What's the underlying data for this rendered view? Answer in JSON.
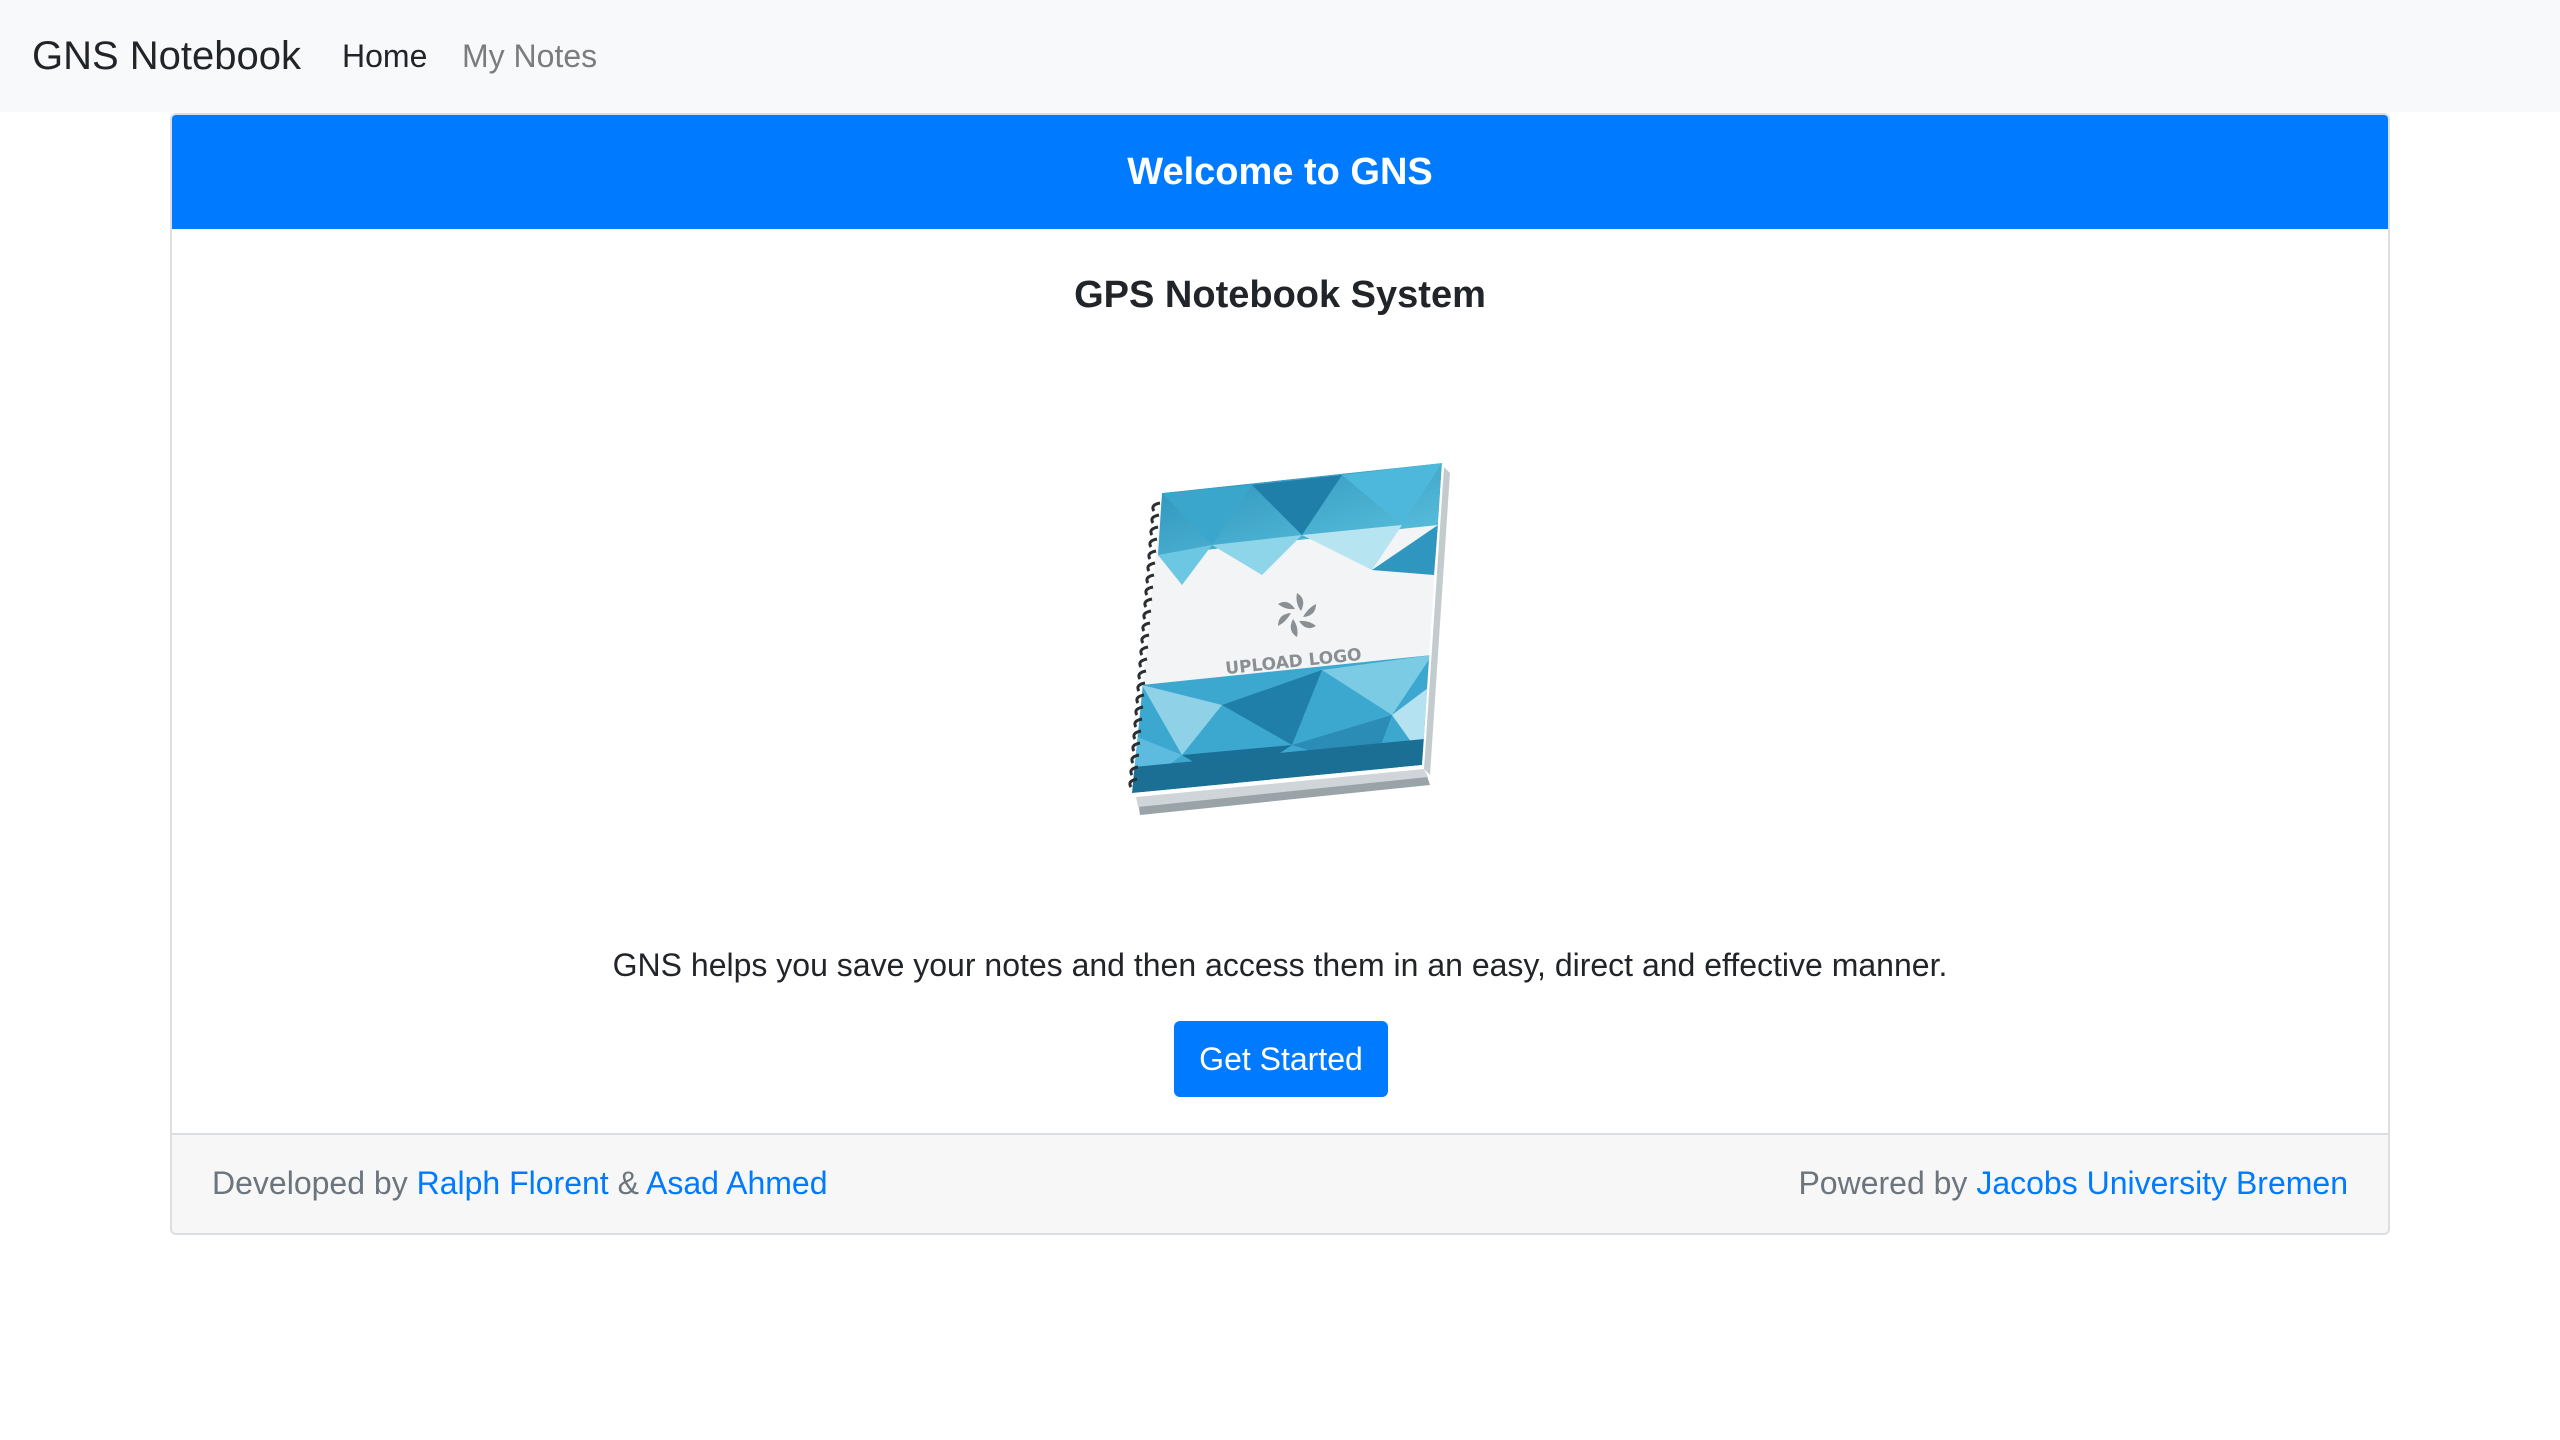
{
  "navbar": {
    "brand": "GNS Notebook",
    "links": [
      {
        "label": "Home",
        "active": true
      },
      {
        "label": "My Notes",
        "active": false
      }
    ]
  },
  "card": {
    "header": "Welcome to GNS",
    "title": "GPS Notebook System",
    "image": {
      "logo_text": "UPLOAD LOGO"
    },
    "description": "GNS helps you save your notes and then access them in an easy, direct and effective manner.",
    "button_label": "Get Started",
    "footer": {
      "developed_prefix": "Developed by ",
      "author1": "Ralph Florent",
      "separator": " & ",
      "author2": "Asad Ahmed",
      "powered_prefix": "Powered by ",
      "org": "Jacobs University Bremen"
    }
  },
  "colors": {
    "primary": "#007bff",
    "navbar_bg": "#f8f9fa",
    "footer_bg": "#f7f7f7",
    "muted_text": "#6c757d"
  }
}
